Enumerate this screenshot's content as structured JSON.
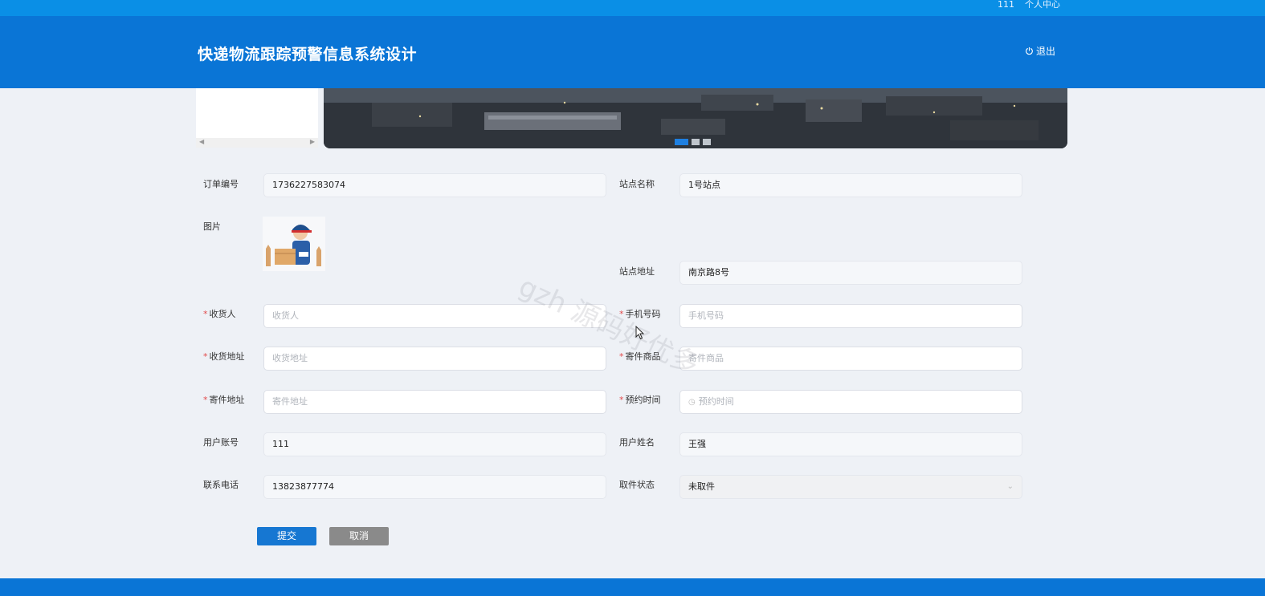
{
  "topbar": {
    "user": "111",
    "center_link": "个人中心"
  },
  "header": {
    "title": "快递物流跟踪预警信息系统设计",
    "logout": "退出"
  },
  "banner": {
    "slides": 3,
    "active_slide": 1
  },
  "form": {
    "order_no": {
      "label": "订单编号",
      "value": "1736227583074"
    },
    "station_name": {
      "label": "站点名称",
      "value": "1号站点"
    },
    "image": {
      "label": "图片"
    },
    "station_addr": {
      "label": "站点地址",
      "value": "南京路8号"
    },
    "receiver": {
      "label": "收货人",
      "placeholder": "收货人"
    },
    "phone": {
      "label": "手机号码",
      "placeholder": "手机号码"
    },
    "receiver_addr": {
      "label": "收货地址",
      "placeholder": "收货地址"
    },
    "goods": {
      "label": "寄件商品",
      "placeholder": "寄件商品"
    },
    "sender_addr": {
      "label": "寄件地址",
      "placeholder": "寄件地址"
    },
    "appt_time": {
      "label": "预约时间",
      "placeholder": "预约时间"
    },
    "account": {
      "label": "用户账号",
      "value": "111"
    },
    "user_name": {
      "label": "用户姓名",
      "value": "王强"
    },
    "contact": {
      "label": "联系电话",
      "value": "13823877774"
    },
    "pickup_status": {
      "label": "取件状态",
      "value": "未取件"
    }
  },
  "buttons": {
    "submit": "提交",
    "cancel": "取消"
  },
  "watermark": "gzh 源码好优多",
  "colors": {
    "header": "#0a75d6",
    "topbar": "#0a8fe6",
    "primary": "#1677d2",
    "required": "#e24b4b"
  }
}
